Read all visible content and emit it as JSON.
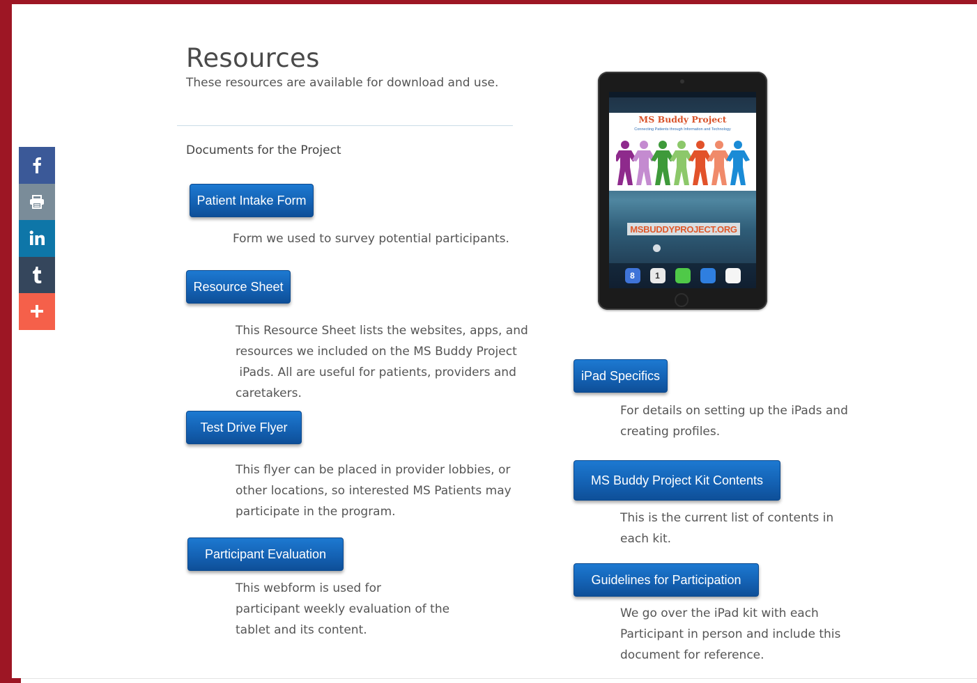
{
  "page": {
    "title": "Resources",
    "subtitle": "These resources are available for download and use.",
    "section_heading": "Documents for the Project"
  },
  "colors": {
    "frame": "#9d1624",
    "button": "#1462b4",
    "facebook": "#3b5998",
    "print": "#7a8c99",
    "linkedin": "#0e76a8",
    "tumblr": "#35465c",
    "more": "#f5604a"
  },
  "share_bar": [
    {
      "name": "facebook",
      "icon": "facebook-icon"
    },
    {
      "name": "print",
      "icon": "print-icon"
    },
    {
      "name": "linkedin",
      "icon": "linkedin-icon"
    },
    {
      "name": "tumblr",
      "icon": "tumblr-icon"
    },
    {
      "name": "more",
      "icon": "plus-icon"
    }
  ],
  "resources_left": [
    {
      "button": "Patient Intake Form",
      "description": [
        "Form we used to survey potential participants."
      ]
    },
    {
      "button": "Resource Sheet",
      "description": [
        "This Resource Sheet lists the websites, apps, and",
        "resources we included on the MS Buddy Project",
        " iPads. All are useful for patients, providers and",
        "caretakers."
      ]
    },
    {
      "button": "Test Drive Flyer",
      "description": [
        "This flyer can be placed in provider lobbies, or",
        "other locations, so interested MS Patients may",
        "participate in the program."
      ]
    },
    {
      "button": "Participant Evaluation",
      "description": [
        "This webform is used for",
        "participant weekly evaluation of the",
        "tablet and its content."
      ]
    }
  ],
  "resources_right": [
    {
      "button": "iPad Specifics",
      "description": [
        "For details on setting up the iPads and",
        "creating profiles."
      ]
    },
    {
      "button": "MS Buddy Project Kit Contents",
      "description": [
        "This is the current list of contents in",
        "each kit."
      ]
    },
    {
      "button": "Guidelines for Participation",
      "description": [
        "We go over the iPad kit with each",
        "Participant in person and include this",
        "document for reference."
      ]
    }
  ],
  "tablet_image": {
    "banner_title": "MS Buddy Project",
    "banner_subtitle": "Connecting Patients through Information and Technology",
    "url": "MSBUDDYPROJECT.ORG",
    "people_colors": [
      "#8e2a8c",
      "#c48bd0",
      "#3e9a3a",
      "#8cc86a",
      "#e2522a",
      "#f08a6a",
      "#1a8bd6"
    ],
    "dock_apps": [
      {
        "icon": "google-icon",
        "label": "8",
        "color": "#3f74d8"
      },
      {
        "icon": "calendar-icon",
        "label": "1",
        "color": "#e9e9e9"
      },
      {
        "icon": "messages-icon",
        "label": "",
        "color": "#4fc948"
      },
      {
        "icon": "mail-icon",
        "label": "",
        "color": "#2f7fe0"
      },
      {
        "icon": "clock-icon",
        "label": "",
        "color": "#f5f5f5"
      }
    ]
  }
}
